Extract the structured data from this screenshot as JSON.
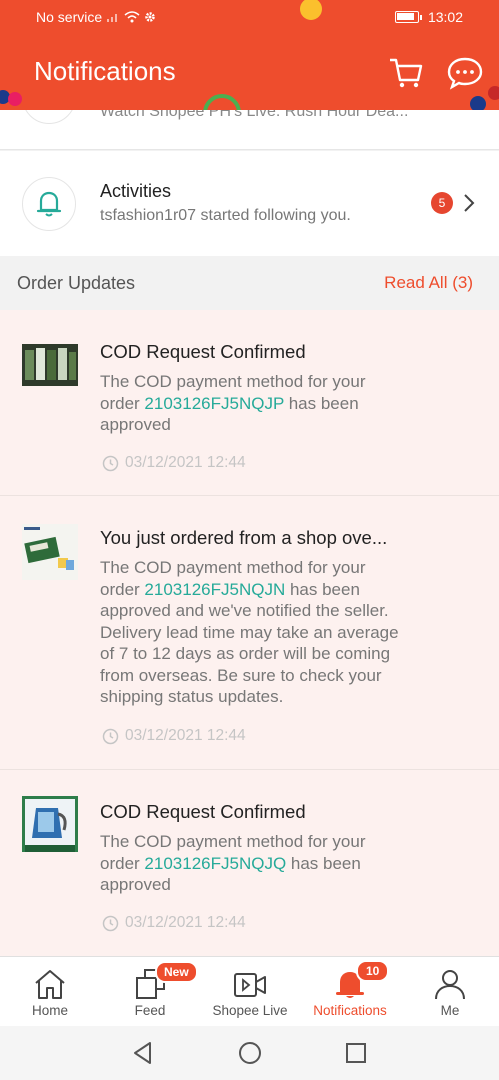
{
  "status_bar": {
    "carrier": "No service",
    "time": "13:02"
  },
  "header": {
    "title": "Notifications",
    "cart_icon": "cart-icon",
    "chat_icon": "chat-icon"
  },
  "partial_row": {
    "subtitle": "Watch Shopee PH's Live: Rush Hour Dea..."
  },
  "activities": {
    "title": "Activities",
    "subtitle": "tsfashion1r07 started following you.",
    "badge": "5"
  },
  "order_updates": {
    "section_title": "Order Updates",
    "read_all": "Read All (3)",
    "items": [
      {
        "title": "COD Request Confirmed",
        "body_prefix": "The COD payment method for your order ",
        "order_id": "2103126FJ5NQJP",
        "body_suffix": " has been approved",
        "time": "03/12/2021 12:44"
      },
      {
        "title": "You just ordered from a shop ove...",
        "body_prefix": "The COD payment method for your order ",
        "order_id": "2103126FJ5NQJN",
        "body_suffix": " has been approved and we've notified the seller. Delivery lead time may take an average of 7 to 12 days as order will be coming from overseas. Be sure to check your shipping status updates.",
        "time": "03/12/2021 12:44"
      },
      {
        "title": "COD Request Confirmed",
        "body_prefix": "The COD payment method for your order ",
        "order_id": "2103126FJ5NQJQ",
        "body_suffix": " has been approved",
        "time": "03/12/2021 12:44"
      }
    ]
  },
  "bottom_nav": {
    "items": [
      {
        "label": "Home",
        "icon": "home-icon"
      },
      {
        "label": "Feed",
        "icon": "feed-icon",
        "badge": "New"
      },
      {
        "label": "Shopee Live",
        "icon": "live-icon"
      },
      {
        "label": "Notifications",
        "icon": "bell-icon",
        "badge": "10",
        "active": true
      },
      {
        "label": "Me",
        "icon": "user-icon"
      }
    ]
  },
  "colors": {
    "brand": "#ee4d2d",
    "order_link": "#26aa99",
    "notif_bg": "#fdf1ef"
  }
}
